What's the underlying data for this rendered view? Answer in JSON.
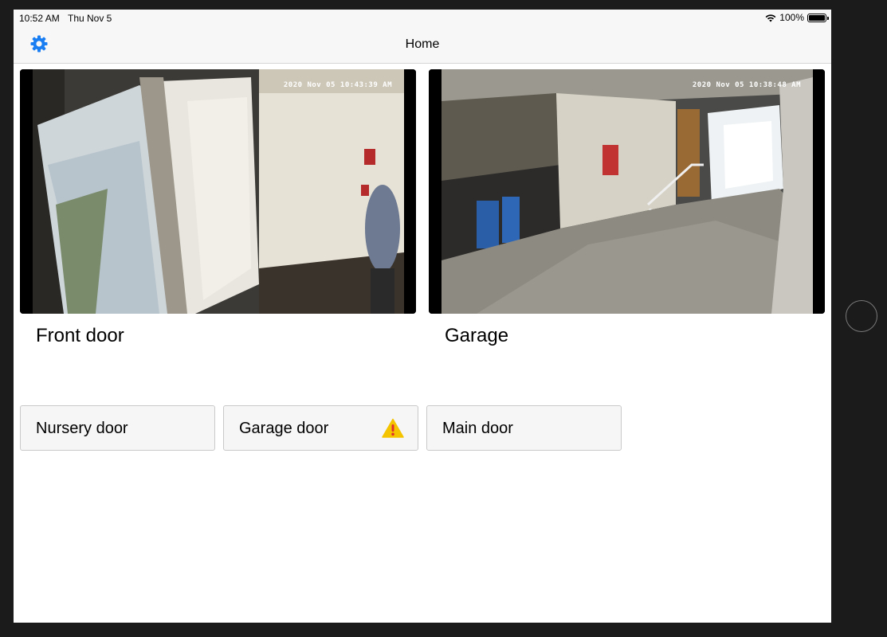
{
  "status_bar": {
    "time": "10:52 AM",
    "date": "Thu Nov 5",
    "battery": "100%"
  },
  "nav": {
    "title": "Home",
    "settings_icon": "gear-icon"
  },
  "cameras": [
    {
      "label": "Front door",
      "timestamp": "2020 Nov 05    10:43:39 AM"
    },
    {
      "label": "Garage",
      "timestamp": "2020 Nov 05    10:38:48 AM"
    }
  ],
  "doors": [
    {
      "label": "Nursery door",
      "warning": false
    },
    {
      "label": "Garage door",
      "warning": true
    },
    {
      "label": "Main door",
      "warning": false
    }
  ],
  "colors": {
    "accent": "#1a7ef3",
    "warning": "#f5c400"
  }
}
